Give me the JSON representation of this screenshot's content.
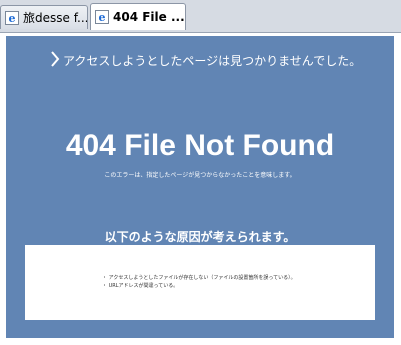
{
  "tabs": [
    {
      "label": "旅desse f...",
      "icon": "ie-icon",
      "active": false
    },
    {
      "label": "404 File ...",
      "icon": "ie-icon",
      "active": true
    }
  ],
  "page": {
    "top_message": "アクセスしようとしたページは見つかりませんでした。",
    "title": "404 File Not Found",
    "subtitle": "このエラーは、指定したページが見つからなかったことを意味します。",
    "causes_heading": "以下のような原因が考えられます。",
    "causes": [
      "・ アクセスしようとしたファイルが存在しない（ファイルの設置箇所を誤っている）。",
      "・ URLアドレスが間違っている。"
    ],
    "background_color": "#6185b4"
  }
}
